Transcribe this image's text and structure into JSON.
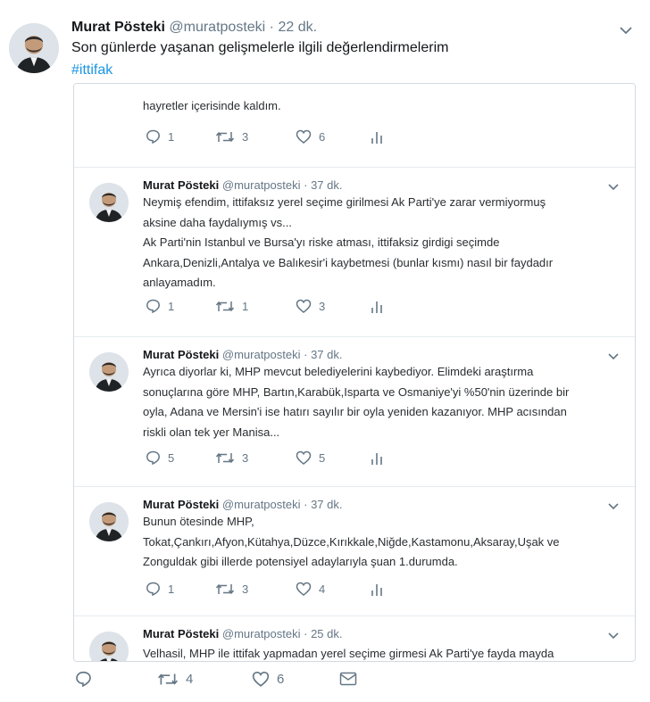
{
  "outer": {
    "name": "Murat Pösteki",
    "handle": "@muratposteki",
    "time": "· 22 dk.",
    "text": "Son günlerde yaşanan gelişmelerle ilgili değerlendirmelerim",
    "hashtag": "#ittifak",
    "replies": "",
    "retweets": "4",
    "likes": "6"
  },
  "thread": [
    {
      "name": "",
      "handle": "",
      "time": "",
      "lines": [
        "hayretler içerisinde kaldım."
      ],
      "replies": "1",
      "retweets": "3",
      "likes": "6"
    },
    {
      "name": "Murat Pösteki",
      "handle": "@muratposteki",
      "time": "· 37 dk.",
      "lines": [
        "Neymiş efendim, ittifaksız yerel seçime girilmesi Ak Parti'ye zarar vermiyormuş",
        "aksine daha faydalıymış vs...",
        "Ak Parti'nin Istanbul ve Bursa'yı riske atması, ittifaksiz girdigi seçimde",
        "Ankara,Denizli,Antalya ve Balıkesir'i kaybetmesi (bunlar kısmı) nasıl bir faydadır",
        "anlayamadım."
      ],
      "replies": "1",
      "retweets": "1",
      "likes": "3"
    },
    {
      "name": "Murat Pösteki",
      "handle": "@muratposteki",
      "time": "· 37 dk.",
      "lines": [
        "Ayrıca diyorlar ki, MHP mevcut belediyelerini kaybediyor. Elimdeki araştırma",
        "sonuçlarına göre MHP, Bartın,Karabük,Isparta ve Osmaniye'yi %50'nin üzerinde bir",
        "oyla, Adana ve Mersin'i ise hatırı sayılır bir oyla yeniden kazanıyor. MHP acısından",
        "riskli olan tek yer Manisa..."
      ],
      "replies": "5",
      "retweets": "3",
      "likes": "5"
    },
    {
      "name": "Murat Pösteki",
      "handle": "@muratposteki",
      "time": "· 37 dk.",
      "lines": [
        "Bunun ötesinde MHP,",
        "Tokat,Çankırı,Afyon,Kütahya,Düzce,Kırıkkale,Niğde,Kastamonu,Aksaray,Uşak ve",
        "Zonguldak gibi illerde potensiyel adaylarıyla şuan 1.durumda."
      ],
      "replies": "1",
      "retweets": "3",
      "likes": "4"
    },
    {
      "name": "Murat Pösteki",
      "handle": "@muratposteki",
      "time": "· 25 dk.",
      "lines": [
        "Velhasil, MHP ile ittifak yapmadan yerel seçime girmesi Ak Parti'ye fayda mayda"
      ],
      "replies": "",
      "retweets": "",
      "likes": ""
    }
  ]
}
